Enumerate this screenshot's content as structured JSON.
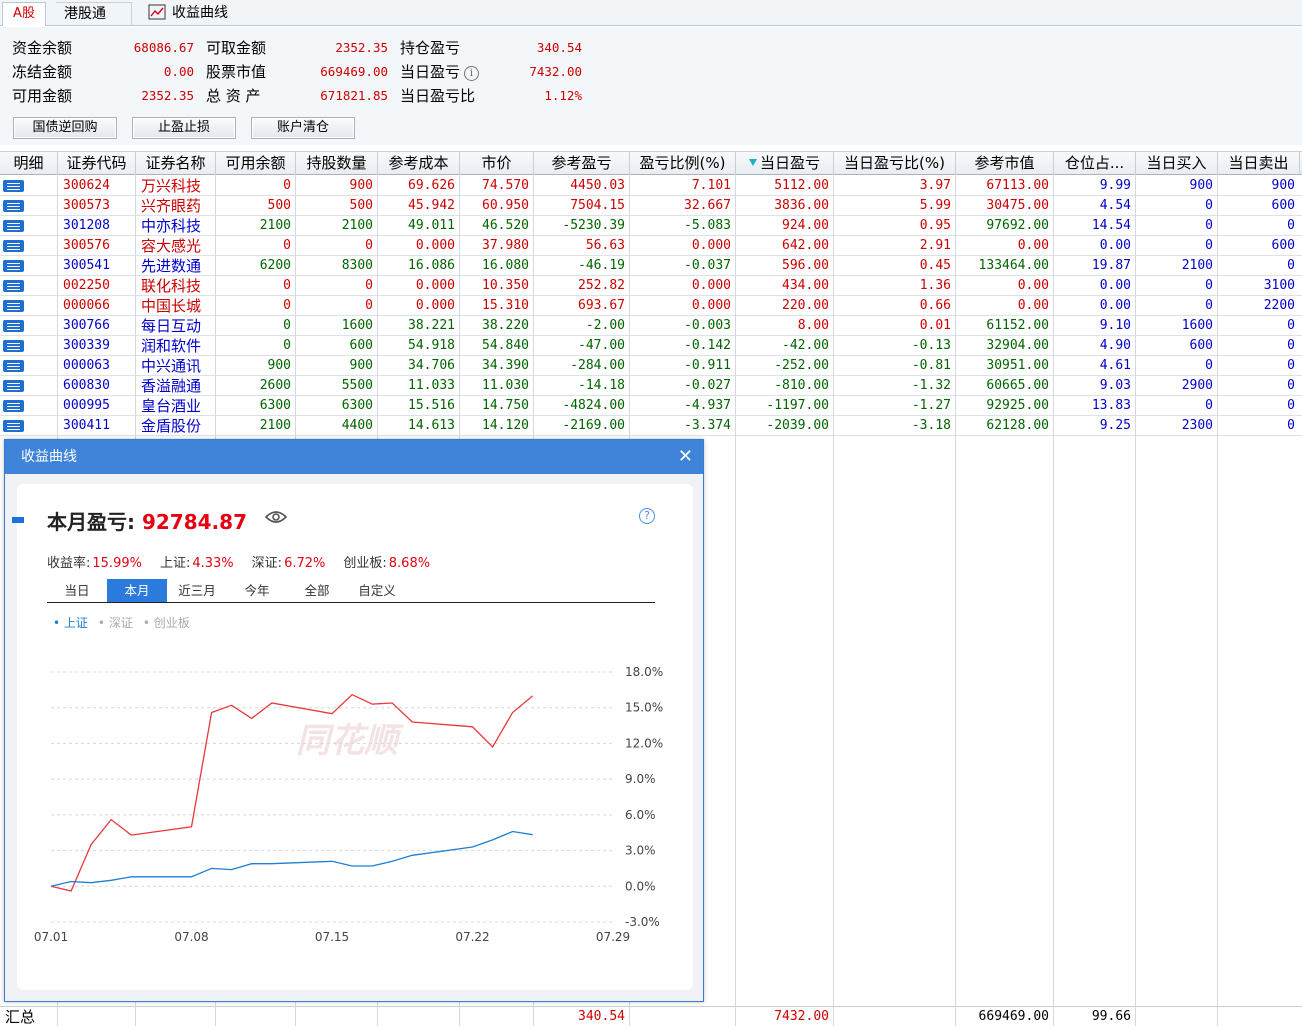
{
  "tabs": {
    "a_share": "A股",
    "hk_connect": "港股通",
    "curve": "收益曲线"
  },
  "summary": {
    "items": [
      {
        "label": "资金余额",
        "value": "68086.67"
      },
      {
        "label": "冻结金额",
        "value": "0.00"
      },
      {
        "label": "可用金额",
        "value": "2352.35"
      },
      {
        "label": "可取金额",
        "value": "2352.35"
      },
      {
        "label": "股票市值",
        "value": "669469.00"
      },
      {
        "label": "总 资 产",
        "value": "671821.85"
      },
      {
        "label": "持仓盈亏",
        "value": "340.54"
      },
      {
        "label": "当日盈亏",
        "value": "7432.00"
      },
      {
        "label": "当日盈亏比",
        "value": "1.12%"
      }
    ],
    "buttons": [
      "国债逆回购",
      "止盈止损",
      "账户清仓"
    ]
  },
  "table": {
    "columns": [
      "明细",
      "证券代码",
      "证券名称",
      "可用余额",
      "持股数量",
      "参考成本",
      "市价",
      "参考盈亏",
      "盈亏比例(%)",
      "当日盈亏",
      "当日盈亏比(%)",
      "参考市值",
      "仓位占...",
      "当日买入",
      "当日卖出"
    ],
    "rows": [
      {
        "trend": "up",
        "cells": [
          "300624",
          "万兴科技",
          "0",
          "900",
          "69.626",
          "74.570",
          "4450.03",
          "7.101",
          "5112.00",
          "3.97",
          "67113.00",
          "9.99",
          "900",
          "900"
        ]
      },
      {
        "trend": "up",
        "cells": [
          "300573",
          "兴齐眼药",
          "500",
          "500",
          "45.942",
          "60.950",
          "7504.15",
          "32.667",
          "3836.00",
          "5.99",
          "30475.00",
          "4.54",
          "0",
          "600"
        ]
      },
      {
        "trend": "down",
        "cells": [
          "301208",
          "中亦科技",
          "2100",
          "2100",
          "49.011",
          "46.520",
          "-5230.39",
          "-5.083",
          "924.00",
          "0.95",
          "97692.00",
          "14.54",
          "0",
          "0"
        ]
      },
      {
        "trend": "up",
        "cells": [
          "300576",
          "容大感光",
          "0",
          "0",
          "0.000",
          "37.980",
          "56.63",
          "0.000",
          "642.00",
          "2.91",
          "0.00",
          "0.00",
          "0",
          "600"
        ]
      },
      {
        "trend": "down",
        "cells": [
          "300541",
          "先进数通",
          "6200",
          "8300",
          "16.086",
          "16.080",
          "-46.19",
          "-0.037",
          "596.00",
          "0.45",
          "133464.00",
          "19.87",
          "2100",
          "0"
        ]
      },
      {
        "trend": "up",
        "cells": [
          "002250",
          "联化科技",
          "0",
          "0",
          "0.000",
          "10.350",
          "252.82",
          "0.000",
          "434.00",
          "1.36",
          "0.00",
          "0.00",
          "0",
          "3100"
        ]
      },
      {
        "trend": "up",
        "cells": [
          "000066",
          "中国长城",
          "0",
          "0",
          "0.000",
          "15.310",
          "693.67",
          "0.000",
          "220.00",
          "0.66",
          "0.00",
          "0.00",
          "0",
          "2200"
        ]
      },
      {
        "trend": "down",
        "cells": [
          "300766",
          "每日互动",
          "0",
          "1600",
          "38.221",
          "38.220",
          "-2.00",
          "-0.003",
          "8.00",
          "0.01",
          "61152.00",
          "9.10",
          "1600",
          "0"
        ]
      },
      {
        "trend": "down",
        "cells": [
          "300339",
          "润和软件",
          "0",
          "600",
          "54.918",
          "54.840",
          "-47.00",
          "-0.142",
          "-42.00",
          "-0.13",
          "32904.00",
          "4.90",
          "600",
          "0"
        ]
      },
      {
        "trend": "down",
        "cells": [
          "000063",
          "中兴通讯",
          "900",
          "900",
          "34.706",
          "34.390",
          "-284.00",
          "-0.911",
          "-252.00",
          "-0.81",
          "30951.00",
          "4.61",
          "0",
          "0"
        ]
      },
      {
        "trend": "down",
        "cells": [
          "600830",
          "香溢融通",
          "2600",
          "5500",
          "11.033",
          "11.030",
          "-14.18",
          "-0.027",
          "-810.00",
          "-1.32",
          "60665.00",
          "9.03",
          "2900",
          "0"
        ]
      },
      {
        "trend": "down",
        "cells": [
          "000995",
          "皇台酒业",
          "6300",
          "6300",
          "15.516",
          "14.750",
          "-4824.00",
          "-4.937",
          "-1197.00",
          "-1.27",
          "92925.00",
          "13.83",
          "0",
          "0"
        ]
      },
      {
        "trend": "down",
        "cells": [
          "300411",
          "金盾股份",
          "2100",
          "4400",
          "14.613",
          "14.120",
          "-2169.00",
          "-3.374",
          "-2039.00",
          "-3.18",
          "62128.00",
          "9.25",
          "2300",
          "0"
        ]
      }
    ],
    "totals": {
      "label": "汇总",
      "pnl": "340.54",
      "day_pnl": "7432.00",
      "market_value": "669469.00",
      "position": "99.66"
    }
  },
  "popup": {
    "title": "收益曲线",
    "month_label": "本月盈亏:",
    "month_value": "92784.87",
    "stats": [
      {
        "label": "收益率:",
        "value": "15.99%"
      },
      {
        "label": "上证:",
        "value": "4.33%"
      },
      {
        "label": "深证:",
        "value": "6.72%"
      },
      {
        "label": "创业板:",
        "value": "8.68%"
      }
    ],
    "ranges": [
      "当日",
      "本月",
      "近三月",
      "今年",
      "全部",
      "自定义"
    ],
    "active_range": "本月",
    "legend": [
      "上证",
      "深证",
      "创业板"
    ],
    "watermark": "同花顺"
  },
  "chart_data": {
    "type": "line",
    "x_ticks": [
      "07.01",
      "07.08",
      "07.15",
      "07.22",
      "07.29"
    ],
    "y_ticks": [
      "18.0%",
      "15.0%",
      "12.0%",
      "9.0%",
      "6.0%",
      "3.0%",
      "0.0%",
      "-3.0%"
    ],
    "ylim": [
      -3,
      18
    ],
    "xlim": [
      "07.01",
      "07.29"
    ],
    "grid": true,
    "colors": {
      "return": "#e8383d",
      "shanghai": "#1e7fd6"
    },
    "series": [
      {
        "color": "#e8383d",
        "x": [
          "07.01",
          "07.02",
          "07.03",
          "07.04",
          "07.05",
          "07.08",
          "07.09",
          "07.10",
          "07.11",
          "07.12",
          "07.15",
          "07.16",
          "07.17",
          "07.18",
          "07.19",
          "07.22",
          "07.23",
          "07.24",
          "07.25"
        ],
        "values": [
          0.0,
          -0.4,
          3.5,
          5.6,
          4.3,
          5.0,
          14.6,
          15.2,
          14.1,
          15.4,
          14.5,
          16.1,
          15.3,
          15.4,
          13.8,
          13.4,
          11.7,
          14.6,
          15.99
        ]
      },
      {
        "name": "上证",
        "color": "#1e7fd6",
        "x": [
          "07.01",
          "07.02",
          "07.03",
          "07.04",
          "07.05",
          "07.08",
          "07.09",
          "07.10",
          "07.11",
          "07.12",
          "07.15",
          "07.16",
          "07.17",
          "07.18",
          "07.19",
          "07.22",
          "07.23",
          "07.24",
          "07.25"
        ],
        "values": [
          0.0,
          0.4,
          0.3,
          0.5,
          0.8,
          0.8,
          1.5,
          1.4,
          1.9,
          1.9,
          2.1,
          1.7,
          1.7,
          2.1,
          2.6,
          3.3,
          3.9,
          4.6,
          4.33
        ]
      }
    ]
  }
}
